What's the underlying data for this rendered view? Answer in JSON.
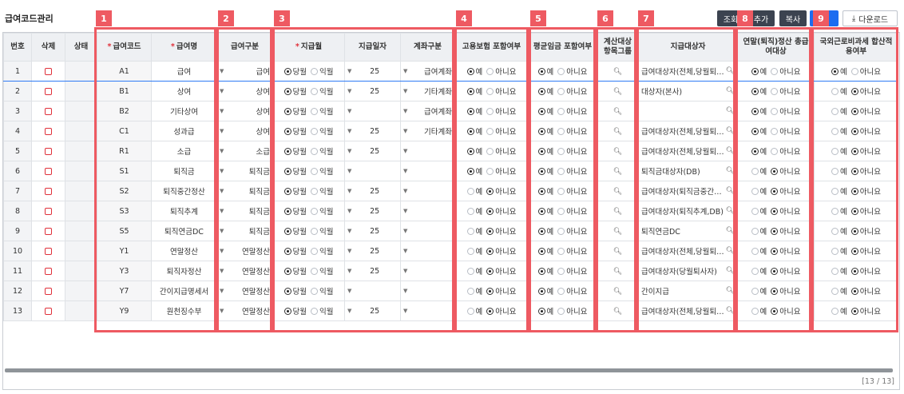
{
  "title": "급여코드관리",
  "toolbar": {
    "query": "조회",
    "add": "추가",
    "copy": "복사",
    "download": "다운로드"
  },
  "columns": {
    "no": "번호",
    "delete": "삭제",
    "status": "상태",
    "code": "급여코드",
    "name": "급여명",
    "category": "급여구분",
    "pay_month": "지급월",
    "pay_day": "지급일자",
    "account": "계좌구분",
    "emp_insurance": "고용보험 포함여부",
    "avg_wage": "평균임금 포함여부",
    "calc_group": "계산대상 항목그룹",
    "target": "지급대상자",
    "annual_total": "연말(퇴직)정산 총급여대상",
    "foreign_tax": "국외근로비과세 합산적용여부"
  },
  "labels": {
    "current_month": "당월",
    "next_month": "익월",
    "yes": "예",
    "no": "아니요"
  },
  "rows": [
    {
      "no": "1",
      "code": "A1",
      "name": "급여",
      "category": "급여",
      "month": "current",
      "day": "25",
      "account": "급여계좌",
      "ins": "yes",
      "avg": "yes",
      "target": "급여대상자(전체,당월퇴사자)",
      "annual": "yes",
      "foreign": "yes"
    },
    {
      "no": "2",
      "code": "B1",
      "name": "상여",
      "category": "상여",
      "month": "current",
      "day": "25",
      "account": "기타계좌",
      "ins": "yes",
      "avg": "yes",
      "target": "대상자(본사)",
      "annual": "yes",
      "foreign": "no"
    },
    {
      "no": "3",
      "code": "B2",
      "name": "기타상여",
      "category": "상여",
      "month": "current",
      "day": "",
      "account": "급여계좌",
      "ins": "yes",
      "avg": "yes",
      "target": "",
      "annual": "yes",
      "foreign": "no"
    },
    {
      "no": "4",
      "code": "C1",
      "name": "성과급",
      "category": "상여",
      "month": "current",
      "day": "25",
      "account": "기타계좌",
      "ins": "yes",
      "avg": "yes",
      "target": "급여대상자(전체,당월퇴사자)",
      "annual": "yes",
      "foreign": "no"
    },
    {
      "no": "5",
      "code": "R1",
      "name": "소급",
      "category": "소급",
      "month": "current",
      "day": "25",
      "account": "",
      "ins": "yes",
      "avg": "yes",
      "target": "급여대상자(전체,당월퇴사자)",
      "annual": "yes",
      "foreign": "no"
    },
    {
      "no": "6",
      "code": "S1",
      "name": "퇴직금",
      "category": "퇴직금",
      "month": "current",
      "day": "",
      "account": "",
      "ins": "yes",
      "avg": "yes",
      "target": "퇴직금대상자(DB)",
      "annual": "no",
      "foreign": "no"
    },
    {
      "no": "7",
      "code": "S2",
      "name": "퇴직중간정산",
      "category": "퇴직금",
      "month": "current",
      "day": "25",
      "account": "",
      "ins": "no",
      "avg": "yes",
      "target": "급여대상자(퇴직금중간정산)",
      "annual": "no",
      "foreign": "no"
    },
    {
      "no": "8",
      "code": "S3",
      "name": "퇴직추계",
      "category": "퇴직금",
      "month": "current",
      "day": "25",
      "account": "",
      "ins": "no",
      "avg": "yes",
      "target": "급여대상자(퇴직추계,DB)",
      "annual": "no",
      "foreign": "no"
    },
    {
      "no": "9",
      "code": "S5",
      "name": "퇴직연금DC",
      "category": "퇴직금",
      "month": "current",
      "day": "25",
      "account": "",
      "ins": "no",
      "avg": "yes",
      "target": "퇴직연금DC",
      "annual": "no",
      "foreign": "no"
    },
    {
      "no": "10",
      "code": "Y1",
      "name": "연말정산",
      "category": "연말정산",
      "month": "current",
      "day": "25",
      "account": "",
      "ins": "no",
      "avg": "yes",
      "target": "급여대상자(전체,당월퇴사자)",
      "annual": "no",
      "foreign": "no"
    },
    {
      "no": "11",
      "code": "Y3",
      "name": "퇴직자정산",
      "category": "연말정산",
      "month": "current",
      "day": "25",
      "account": "",
      "ins": "no",
      "avg": "yes",
      "target": "급여대상자(당월퇴사자)",
      "annual": "no",
      "foreign": "no"
    },
    {
      "no": "12",
      "code": "Y7",
      "name": "간이지급명세서",
      "category": "연말정산",
      "month": "current",
      "day": "",
      "account": "",
      "ins": "no",
      "avg": "yes",
      "target": "간이지급",
      "annual": "no",
      "foreign": "no"
    },
    {
      "no": "13",
      "code": "Y9",
      "name": "원천징수부",
      "category": "연말정산",
      "month": "current",
      "day": "25",
      "account": "",
      "ins": "no",
      "avg": "yes",
      "target": "급여대상자(전체,당월퇴사자)",
      "annual": "no",
      "foreign": "no"
    }
  ],
  "annotations": [
    "1",
    "2",
    "3",
    "4",
    "5",
    "6",
    "7",
    "8",
    "9"
  ],
  "pager": "[13 / 13]"
}
